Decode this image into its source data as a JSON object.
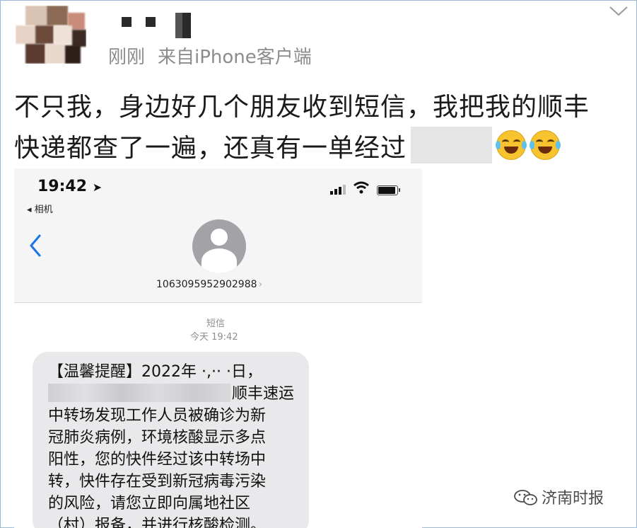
{
  "post": {
    "meta_time": "刚刚",
    "meta_source": "来自iPhone客户端",
    "text_line1": "不只我，身边好几个朋友收到短信，我把我的顺丰",
    "text_line2": "快递都查了一遍，还真有一单经过",
    "emoji": "laughing-crying-emoji"
  },
  "screenshot": {
    "status_time": "19:42",
    "back_app_label": "◂ 相机",
    "sender_number": "1063095952902988",
    "sender_arrow": "›",
    "service_label": "短信",
    "message_time": "今天 19:42",
    "message_lines": [
      "【温馨提醒】2022年 ·,·· ·日，",
      "顺丰速运",
      "中转场发现工作人员被确诊为新",
      "冠肺炎病例，环境核酸显示多点",
      "阳性，您的快件经过该中转场中",
      "转，快件存在受到新冠病毒污染",
      "的风险，请您立即向属地社区",
      "（村）报备，并进行核酸检测。"
    ]
  },
  "watermark": {
    "text": "济南时报"
  },
  "colors": {
    "border": "#9db8d6",
    "meta": "#8c8c8c",
    "ios_blue": "#1a73e8",
    "bubble": "#e9e9eb"
  }
}
